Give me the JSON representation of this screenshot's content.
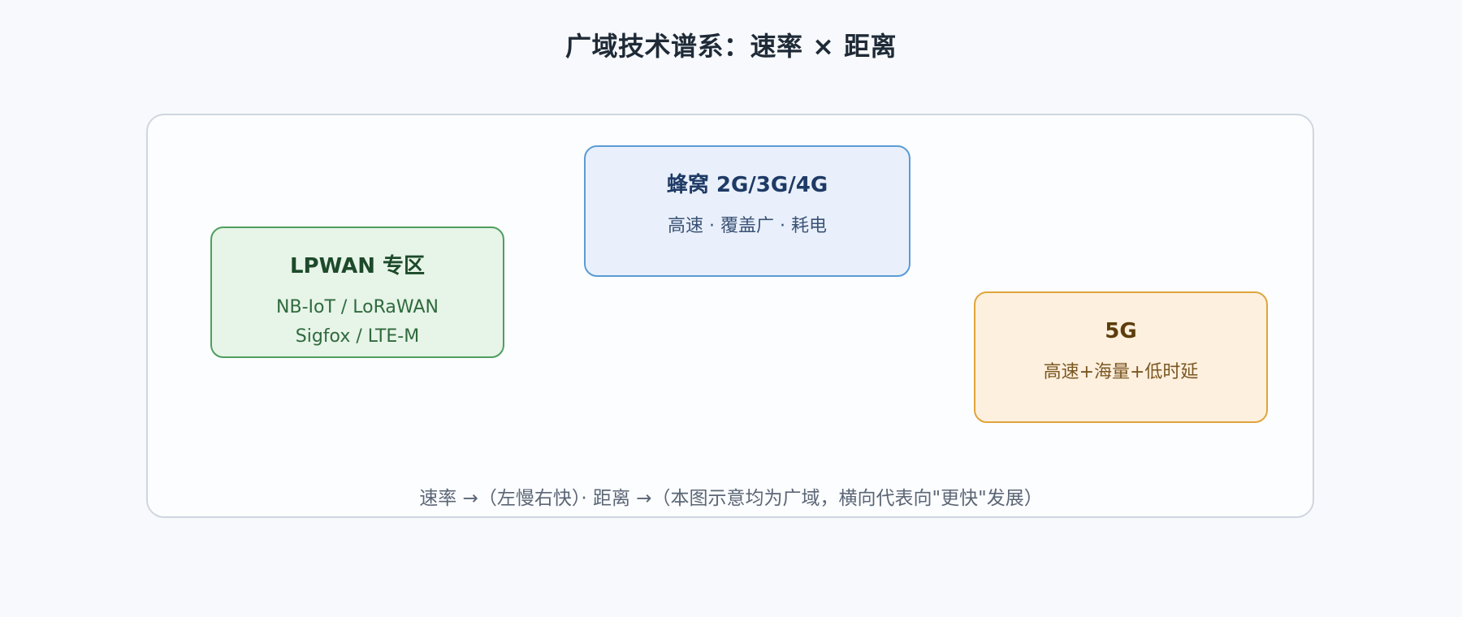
{
  "title": "广域技术谱系：速率 × 距离",
  "boxes": {
    "cellular": {
      "title": "蜂窝 2G/3G/4G",
      "desc": "高速 · 覆盖广 · 耗电"
    },
    "lpwan": {
      "title": "LPWAN 专区",
      "desc_lines": [
        "NB-IoT / LoRaWAN",
        "Sigfox / LTE-M"
      ]
    },
    "five_g": {
      "title": "5G",
      "desc": "高速+海量+低时延"
    }
  },
  "footnote": "速率 →（左慢右快）· 距离 →（本图示意均为广域，横向代表向\"更快\"发展）",
  "colors": {
    "cellular_border": "#5b9bd5",
    "lpwan_border": "#4e9e5e",
    "five_g_border": "#e0a53b"
  }
}
